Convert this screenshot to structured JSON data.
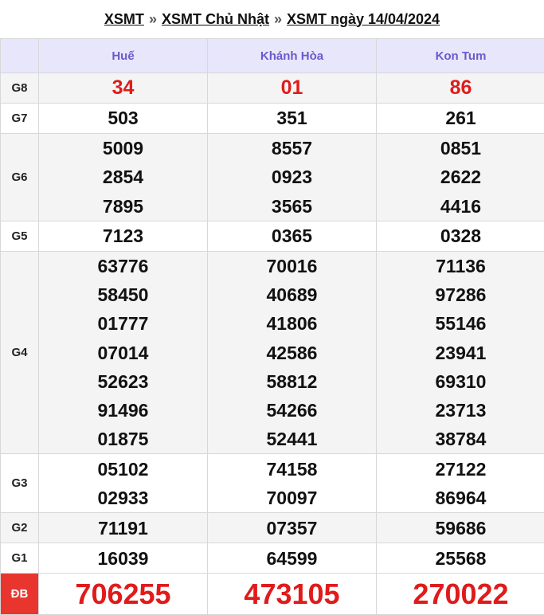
{
  "breadcrumb": {
    "items": [
      "XSMT",
      "XSMT Chủ Nhật",
      "XSMT ngày 14/04/2024"
    ],
    "separator": "»"
  },
  "provinces": [
    "Huế",
    "Khánh Hòa",
    "Kon Tum"
  ],
  "rows": [
    {
      "label": "G8",
      "values": [
        [
          "34"
        ],
        [
          "01"
        ],
        [
          "86"
        ]
      ]
    },
    {
      "label": "G7",
      "values": [
        [
          "503"
        ],
        [
          "351"
        ],
        [
          "261"
        ]
      ]
    },
    {
      "label": "G6",
      "values": [
        [
          "5009",
          "2854",
          "7895"
        ],
        [
          "8557",
          "0923",
          "3565"
        ],
        [
          "0851",
          "2622",
          "4416"
        ]
      ]
    },
    {
      "label": "G5",
      "values": [
        [
          "7123"
        ],
        [
          "0365"
        ],
        [
          "0328"
        ]
      ]
    },
    {
      "label": "G4",
      "values": [
        [
          "63776",
          "58450",
          "01777",
          "07014",
          "52623",
          "91496",
          "01875"
        ],
        [
          "70016",
          "40689",
          "41806",
          "42586",
          "58812",
          "54266",
          "52441"
        ],
        [
          "71136",
          "97286",
          "55146",
          "23941",
          "69310",
          "23713",
          "38784"
        ]
      ]
    },
    {
      "label": "G3",
      "values": [
        [
          "05102",
          "02933"
        ],
        [
          "74158",
          "70097"
        ],
        [
          "27122",
          "86964"
        ]
      ]
    },
    {
      "label": "G2",
      "values": [
        [
          "71191"
        ],
        [
          "07357"
        ],
        [
          "59686"
        ]
      ]
    },
    {
      "label": "G1",
      "values": [
        [
          "16039"
        ],
        [
          "64599"
        ],
        [
          "25568"
        ]
      ]
    },
    {
      "label": "ĐB",
      "values": [
        [
          "706255"
        ],
        [
          "473105"
        ],
        [
          "270022"
        ]
      ]
    }
  ],
  "colors": {
    "header_bg": "#e8e6fb",
    "header_text": "#6a5acd",
    "prize_red": "#e01b1b",
    "db_label_bg": "#e8362f"
  }
}
